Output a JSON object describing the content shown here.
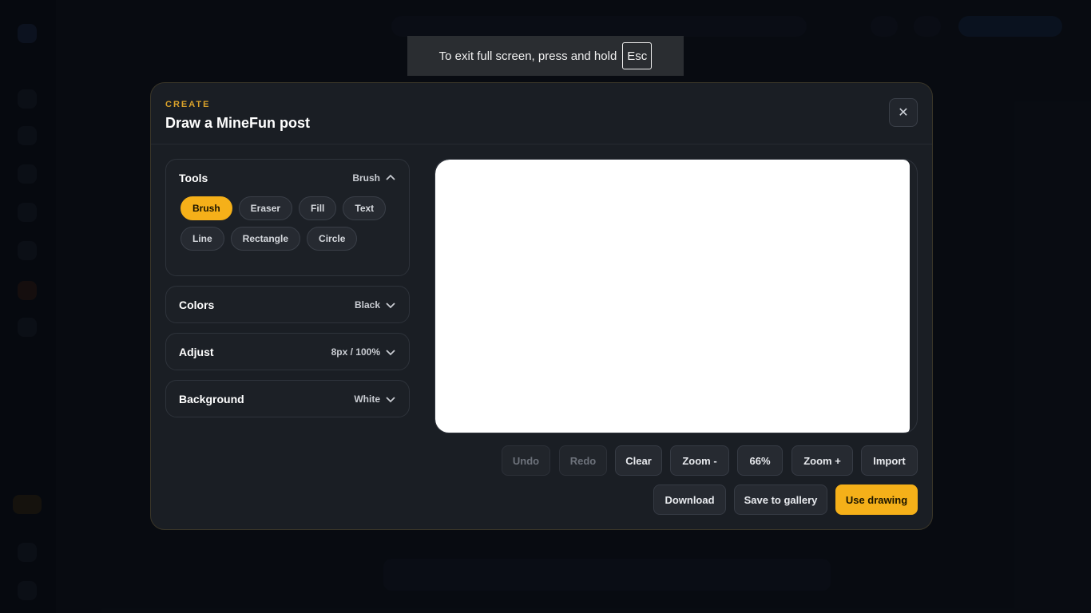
{
  "fullscreen_notice": {
    "text": "To exit full screen, press and hold",
    "key": "Esc"
  },
  "modal": {
    "eyebrow": "CREATE",
    "title": "Draw a MineFun post",
    "close_label": "✕"
  },
  "panels": {
    "tools": {
      "title": "Tools",
      "value": "Brush",
      "expanded": true,
      "items": [
        "Brush",
        "Eraser",
        "Fill",
        "Text",
        "Line",
        "Rectangle",
        "Circle"
      ],
      "selected": "Brush"
    },
    "colors": {
      "title": "Colors",
      "value": "Black",
      "expanded": false
    },
    "adjust": {
      "title": "Adjust",
      "value": "8px / 100%",
      "expanded": false
    },
    "background": {
      "title": "Background",
      "value": "White",
      "expanded": false
    }
  },
  "toolbar": {
    "undo": "Undo",
    "redo": "Redo",
    "clear": "Clear",
    "zoom_out": "Zoom -",
    "zoom_level": "66%",
    "zoom_in": "Zoom +",
    "import": "Import",
    "download": "Download",
    "save_gallery": "Save to gallery",
    "use_drawing": "Use drawing"
  },
  "colors": {
    "accent": "#f5b019",
    "eyebrow": "#d9a12a",
    "modal_bg": "#1a1e24",
    "canvas": "#ffffff"
  }
}
